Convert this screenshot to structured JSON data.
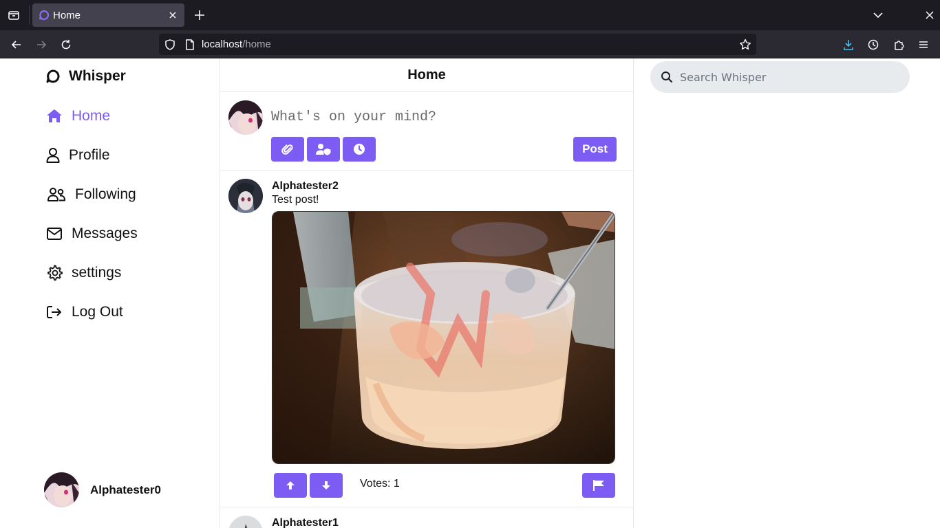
{
  "browser": {
    "tab_title": "Home",
    "url_host": "localhost",
    "url_path": "/home"
  },
  "app": {
    "brand": "Whisper",
    "accent_color": "#7c5cf2",
    "nav": [
      {
        "label": "Home",
        "icon": "home-icon",
        "active": true
      },
      {
        "label": "Profile",
        "icon": "user-icon",
        "active": false
      },
      {
        "label": "Following",
        "icon": "users-icon",
        "active": false
      },
      {
        "label": "Messages",
        "icon": "envelope-icon",
        "active": false
      },
      {
        "label": "settings",
        "icon": "gear-icon",
        "active": false
      },
      {
        "label": "Log Out",
        "icon": "logout-icon",
        "active": false
      }
    ],
    "current_user": "Alphatester0"
  },
  "feed": {
    "title": "Home",
    "composer": {
      "placeholder": "What's on your mind?",
      "post_label": "Post",
      "tool_icons": [
        "paperclip-icon",
        "user-shield-icon",
        "clock-icon"
      ]
    },
    "posts": [
      {
        "author": "Alphatester2",
        "text": "Test post!",
        "votes_label": "Votes: 1"
      },
      {
        "author": "Alphatester1"
      }
    ]
  },
  "search": {
    "placeholder": "Search Whisper"
  }
}
